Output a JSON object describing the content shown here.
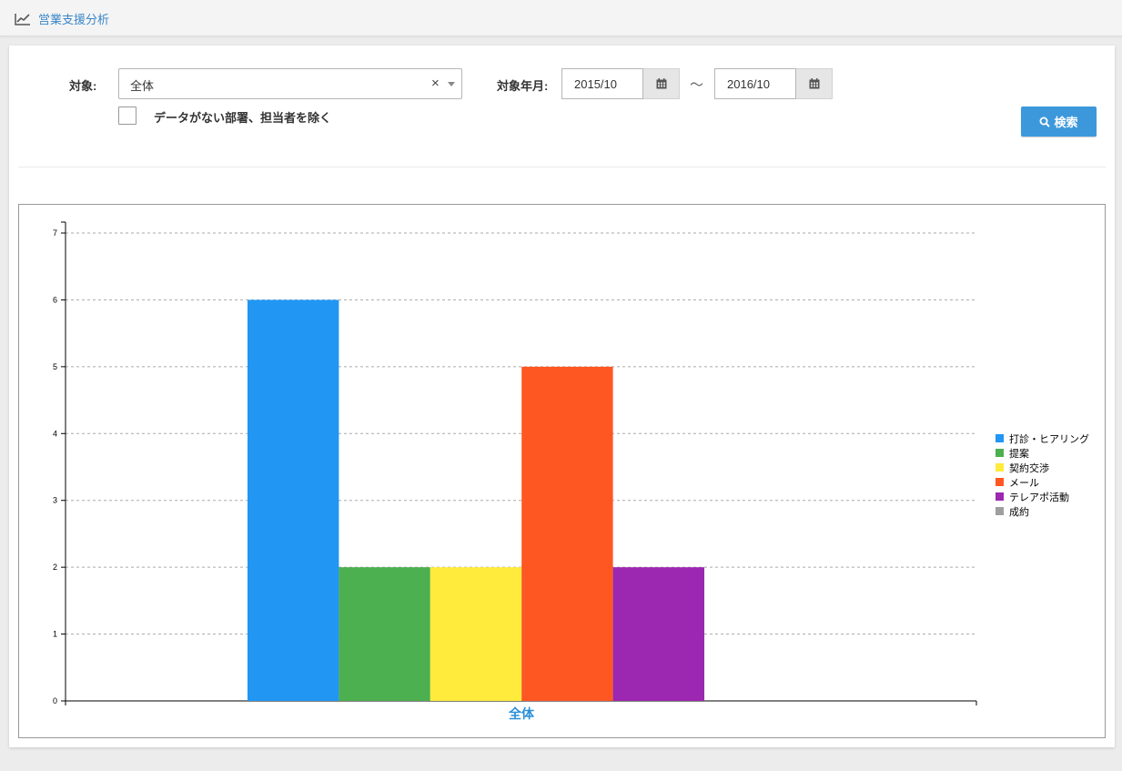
{
  "header": {
    "title": "営業支援分析",
    "icon": "line-chart-icon"
  },
  "filters": {
    "target_label": "対象:",
    "target_value": "全体",
    "clear_symbol": "×",
    "period_label": "対象年月:",
    "date_from": "2015/10",
    "date_to": "2016/10",
    "tilde": "～",
    "exclude_label": "データがない部署、担当者を除く",
    "search_label": "検索"
  },
  "colors": {
    "accent": "#3c98db",
    "link": "#3a87c7"
  },
  "chart_data": {
    "type": "bar",
    "categories": [
      "全体"
    ],
    "series": [
      {
        "name": "打診・ヒアリング",
        "values": [
          6
        ],
        "color": "#2196f3"
      },
      {
        "name": "提案",
        "values": [
          2
        ],
        "color": "#4caf50"
      },
      {
        "name": "契約交渉",
        "values": [
          2
        ],
        "color": "#ffeb3b"
      },
      {
        "name": "メール",
        "values": [
          5
        ],
        "color": "#ff5722"
      },
      {
        "name": "テレアポ活動",
        "values": [
          2
        ],
        "color": "#9c27b0"
      },
      {
        "name": "成約",
        "values": [
          0
        ],
        "color": "#9e9e9e"
      }
    ],
    "ylim": [
      0,
      7
    ],
    "yticks": [
      "0",
      "1",
      "2",
      "3",
      "4",
      "5",
      "6",
      "7"
    ],
    "grid": true,
    "legend": "right"
  }
}
